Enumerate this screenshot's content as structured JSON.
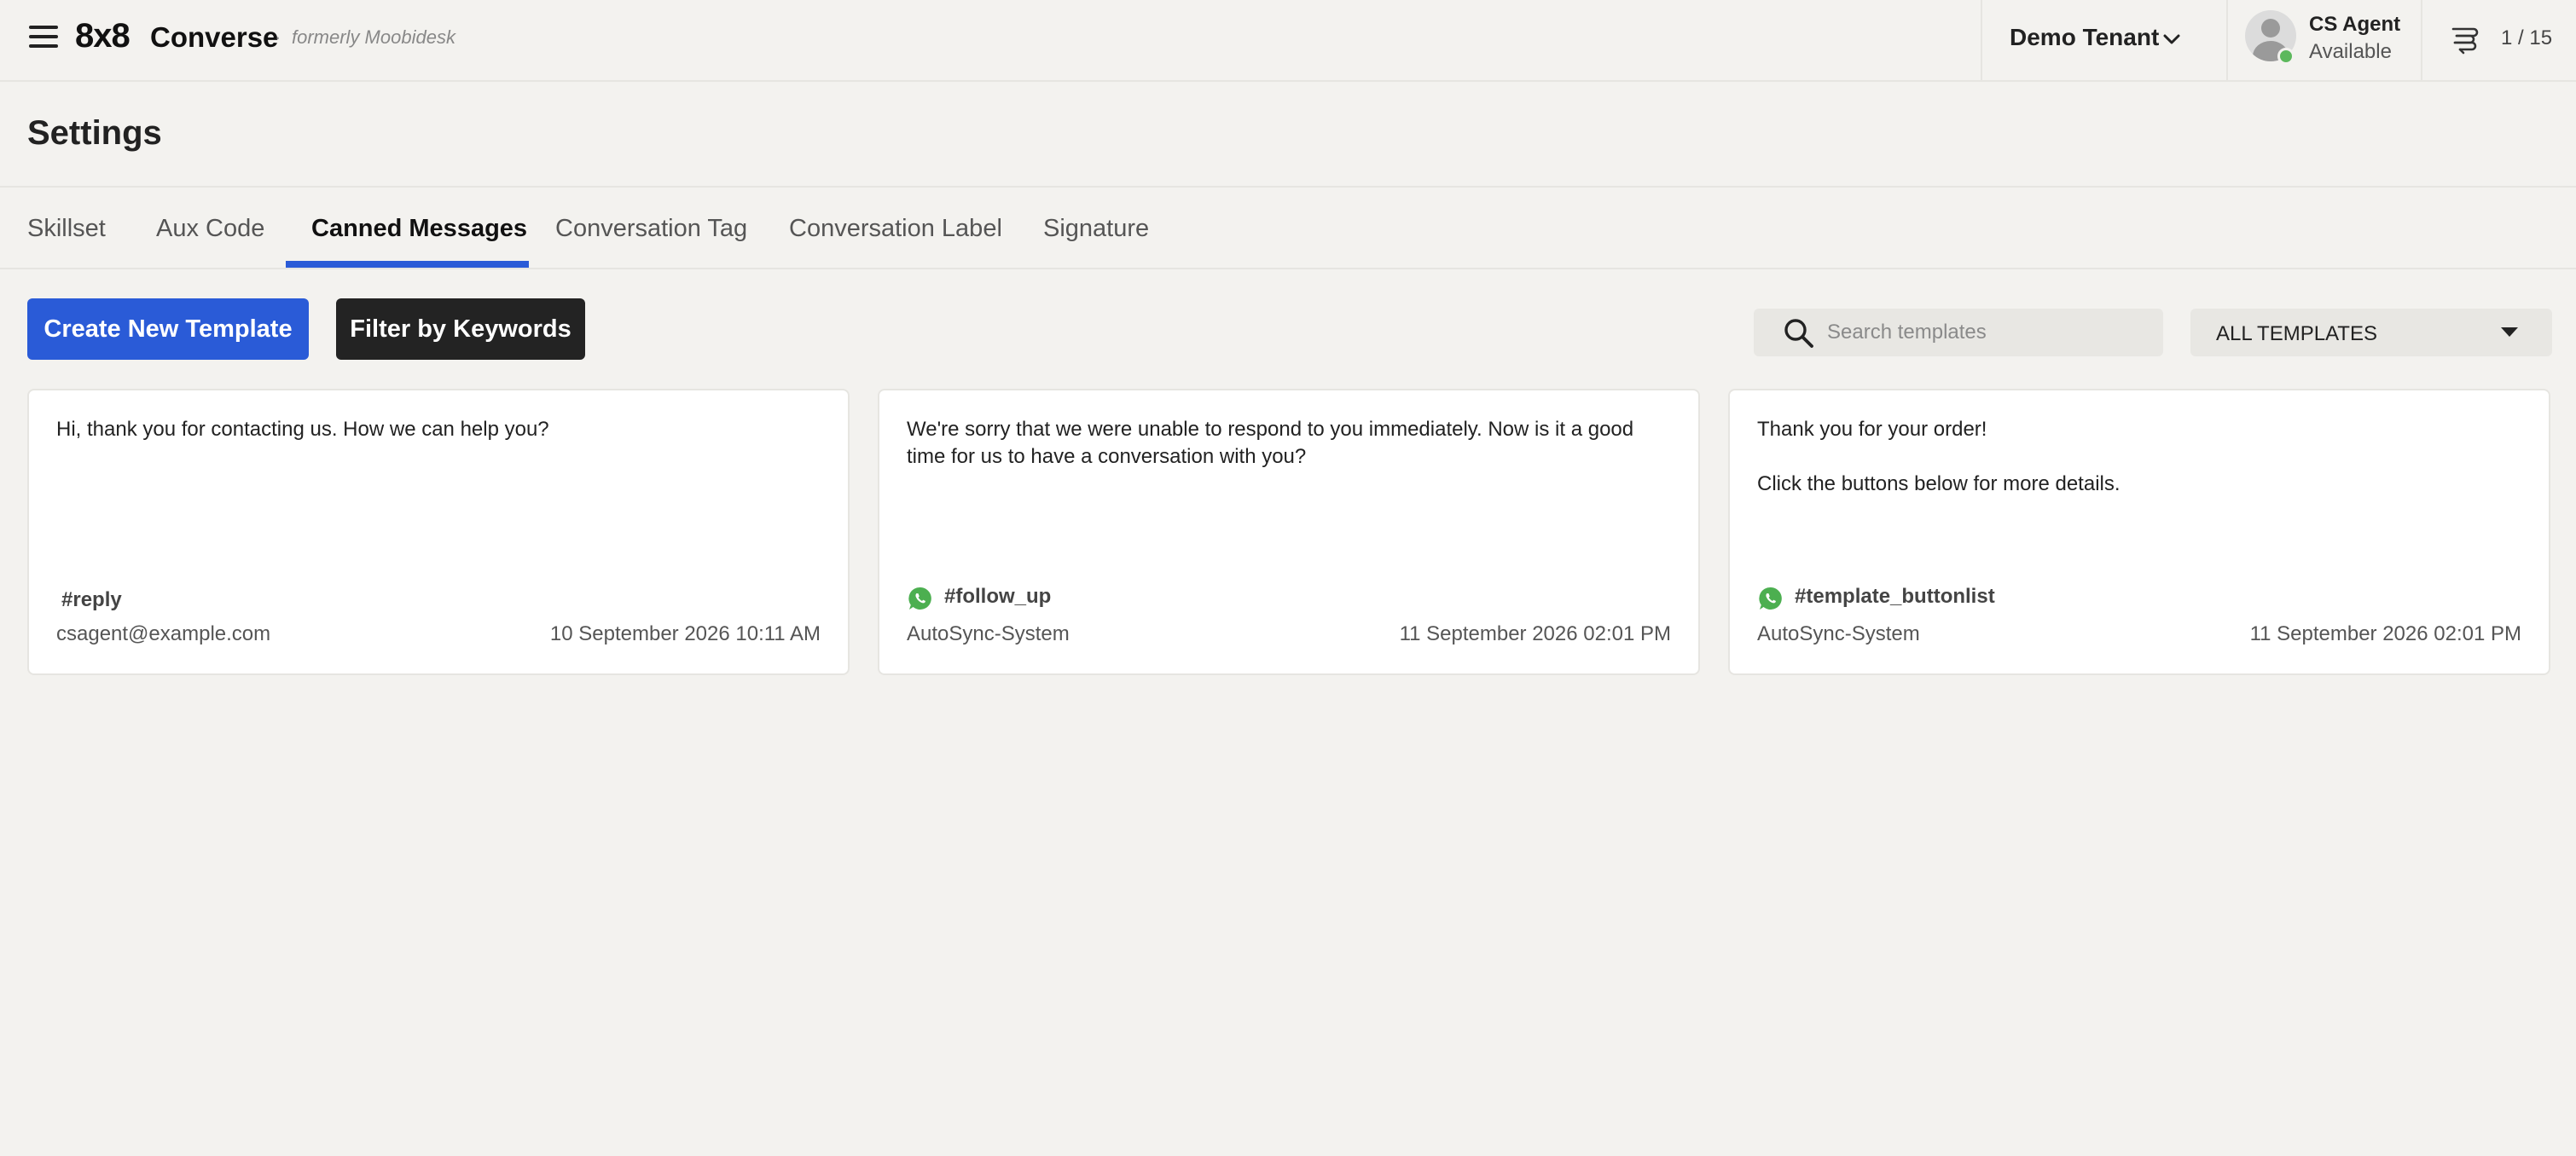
{
  "header": {
    "logo_brand": "8x8",
    "logo_product": "Converse",
    "logo_separator": "·",
    "logo_formerly": "formerly Moobidesk",
    "tenant": "Demo Tenant",
    "agent_name": "CS Agent",
    "agent_status": "Available",
    "queue_count": "1 / 15"
  },
  "page": {
    "title": "Settings"
  },
  "tabs": [
    {
      "label": "Skillset"
    },
    {
      "label": "Aux Code"
    },
    {
      "label": "Canned Messages",
      "active": true
    },
    {
      "label": "Conversation Tag"
    },
    {
      "label": "Conversation Label"
    },
    {
      "label": "Signature"
    }
  ],
  "toolbar": {
    "create_label": "Create New Template",
    "filter_label": "Filter by Keywords",
    "search_placeholder": "Search templates",
    "filter_select_value": "ALL TEMPLATES"
  },
  "cards": [
    {
      "body": "Hi, thank you for contacting us. How we can help you?",
      "tag": "#reply",
      "channel_icon": "none",
      "author": "csagent@example.com",
      "date": "10 September 2026 10:11 AM"
    },
    {
      "body": "We're sorry that we were unable to respond to you immediately. Now is it a good time for us to have a conversation with you?",
      "tag": "#follow_up",
      "channel_icon": "whatsapp-icon",
      "author": "AutoSync-System",
      "date": "11 September 2026 02:01 PM"
    },
    {
      "body": "Thank you for your order!\n\nClick the buttons below for more details.",
      "tag": "#template_buttonlist",
      "channel_icon": "whatsapp-icon",
      "author": "AutoSync-System",
      "date": "11 September 2026 02:01 PM"
    }
  ],
  "colors": {
    "accent": "#2a5bd7",
    "dark_button": "#232323",
    "status_available": "#5cb85c",
    "whatsapp": "#4caf50",
    "background": "#f3f2ef"
  }
}
